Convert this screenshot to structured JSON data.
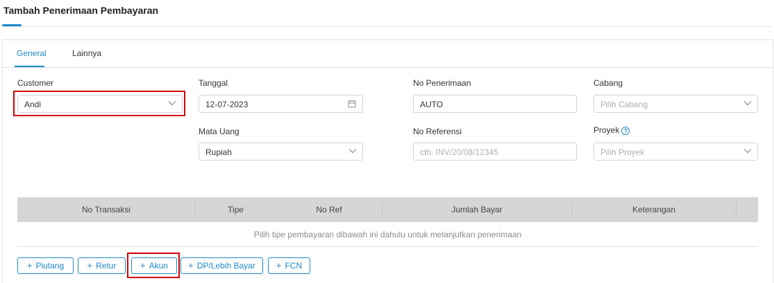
{
  "page": {
    "title": "Tambah Penerimaan Pembayaran"
  },
  "tabs": [
    {
      "label": "General"
    },
    {
      "label": "Lainnya"
    }
  ],
  "form": {
    "customer": {
      "label": "Customer",
      "value": "Andi"
    },
    "tanggal": {
      "label": "Tanggal",
      "value": "12-07-2023"
    },
    "no_penerimaan": {
      "label": "No Penerimaan",
      "value": "AUTO"
    },
    "cabang": {
      "label": "Cabang",
      "placeholder": "Pilih Cabang"
    },
    "mata_uang": {
      "label": "Mata Uang",
      "value": "Rupiah"
    },
    "no_referensi": {
      "label": "No Referensi",
      "placeholder": "cth. INV/20/08/12345"
    },
    "proyek": {
      "label": "Proyek",
      "placeholder": "Pilih Proyek",
      "help_icon": "?"
    }
  },
  "table": {
    "columns": [
      "No Transaksi",
      "Tipe",
      "No Ref",
      "Jumlah Bayar",
      "Keterangan"
    ],
    "empty_message": "Pilih tipe pembayaran dibawah ini dahulu untuk melanjutkan penerimaan"
  },
  "buttons": {
    "plus_symbol": "+",
    "piutang": "Piutang",
    "retur": "Retur",
    "akun": "Akun",
    "dp": "DP/Lebih Bayar",
    "fcn": "FCN"
  },
  "colors": {
    "accent": "#1e88c7",
    "highlight": "#d00000",
    "table_header": "#d6d6d6"
  }
}
